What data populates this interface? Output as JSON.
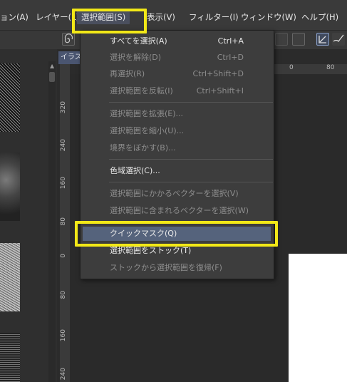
{
  "menubar": {
    "items": [
      {
        "label": "ョン(A)"
      },
      {
        "label": "レイヤー(L)"
      },
      {
        "label": "選択範囲(S)"
      },
      {
        "label": "表示(V)"
      },
      {
        "label": "フィルター(I)"
      },
      {
        "label": "ウィンドウ(W)"
      },
      {
        "label": "ヘルプ(H)"
      }
    ]
  },
  "canvas": {
    "tab_label": "イラス",
    "vruler_ticks": [
      "320",
      "240",
      "160",
      "80",
      "0",
      "80",
      "160",
      "240"
    ],
    "hruler_ticks": [
      "0",
      "80"
    ]
  },
  "dropdown": {
    "items": [
      {
        "label": "すべてを選択(A)",
        "shortcut": "Ctrl+A",
        "enabled": true
      },
      {
        "label": "選択を解除(D)",
        "shortcut": "Ctrl+D",
        "enabled": false
      },
      {
        "label": "再選択(R)",
        "shortcut": "Ctrl+Shift+D",
        "enabled": false
      },
      {
        "label": "選択範囲を反転(I)",
        "shortcut": "Ctrl+Shift+I",
        "enabled": false
      },
      {
        "label": "選択範囲を拡張(E)...",
        "shortcut": "",
        "enabled": false
      },
      {
        "label": "選択範囲を縮小(U)...",
        "shortcut": "",
        "enabled": false
      },
      {
        "label": "境界をぼかす(B)...",
        "shortcut": "",
        "enabled": false
      },
      {
        "label": "色域選択(C)...",
        "shortcut": "",
        "enabled": true
      },
      {
        "label": "選択範囲にかかるベクターを選択(V)",
        "shortcut": "",
        "enabled": false
      },
      {
        "label": "選択範囲に含まれるベクターを選択(W)",
        "shortcut": "",
        "enabled": false
      },
      {
        "label": "クイックマスク(Q)",
        "shortcut": "",
        "enabled": true
      },
      {
        "label": "選択範囲をストック(T)",
        "shortcut": "",
        "enabled": true
      },
      {
        "label": "ストックから選択範囲を復帰(F)",
        "shortcut": "",
        "enabled": false
      }
    ]
  },
  "colors": {
    "highlight": "#f2e817",
    "menu_hover": "#55637c"
  }
}
